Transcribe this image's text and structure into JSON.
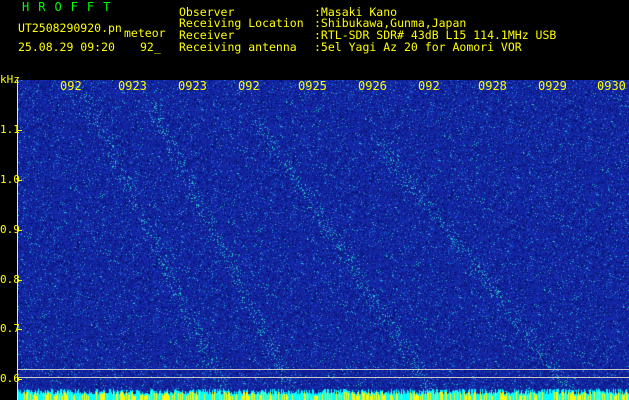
{
  "header": {
    "app_title": "HROFFT",
    "file_name": "UT2508290920.pn",
    "file_type": "meteor",
    "date_time": "25.08.29 09:20",
    "counter": "92_"
  },
  "metadata": {
    "observer_label": "Observer",
    "observer_value": ":Masaki Kano",
    "location_label": "Receiving Location",
    "location_value": ":Shibukawa,Gunma,Japan",
    "receiver_label": "Receiver",
    "receiver_value": ":RTL-SDR SDR# 43dB L15 114.1MHz USB",
    "antenna_label": "Receiving antenna",
    "antenna_value": ":5el Yagi Az 20 for Aomori VOR"
  },
  "axes": {
    "y_unit": "kHz",
    "y_ticks": [
      "1.1",
      "1.0",
      "0.9",
      "0.8",
      "0.7",
      "0.6"
    ],
    "x_ticks": [
      "092",
      "0923",
      "0923",
      "092",
      "0925",
      "0926",
      "092",
      "0928",
      "0929",
      "0930"
    ]
  },
  "colors": {
    "background": "#000000",
    "text": "#ffff00",
    "title": "#00ff00",
    "waterfall_base": "#1b36b8",
    "noise_floor": "#00ffff"
  }
}
